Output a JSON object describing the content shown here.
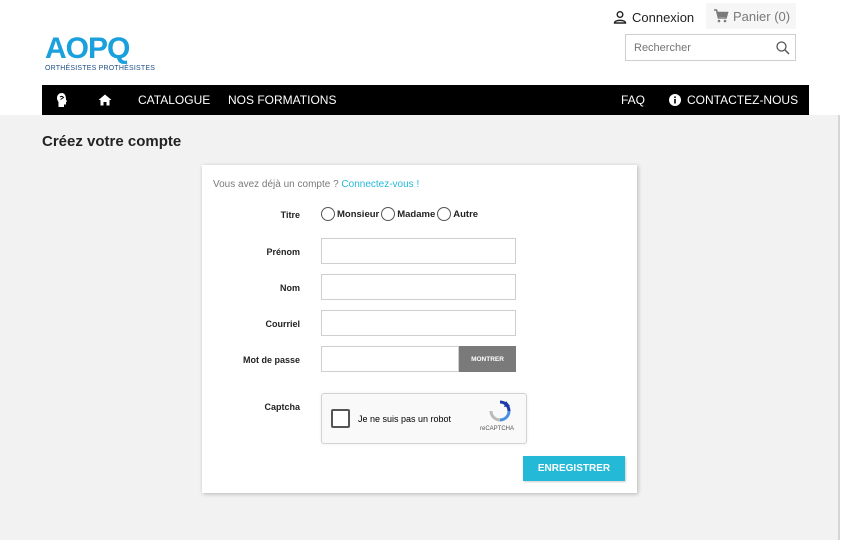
{
  "header": {
    "logo_text": "AOPQ",
    "logo_tagline": "ORTHÉSISTES PROTHÉSISTES",
    "signin_label": "Connexion",
    "cart_label": "Panier (0)",
    "search_placeholder": "Rechercher"
  },
  "nav": {
    "catalogue": "CATALOGUE",
    "formations": "NOS FORMATIONS",
    "faq": "FAQ",
    "contact": "CONTACTEZ-NOUS"
  },
  "page": {
    "title": "Créez votre compte"
  },
  "form": {
    "already_text": "Vous avez déjà un compte ?",
    "login_link": "Connectez-vous !",
    "labels": {
      "titre": "Titre",
      "prenom": "Prénom",
      "nom": "Nom",
      "courriel": "Courriel",
      "password": "Mot de passe",
      "captcha": "Captcha"
    },
    "title_options": [
      "Monsieur",
      "Madame",
      "Autre"
    ],
    "show_button": "MONTRER",
    "captcha_text": "Je ne suis pas un robot",
    "captcha_brand": "reCAPTCHA",
    "submit_label": "ENREGISTRER"
  },
  "colors": {
    "accent": "#24b9d7",
    "nav_bg": "#000000",
    "logo_blue": "#1aa0dc"
  }
}
